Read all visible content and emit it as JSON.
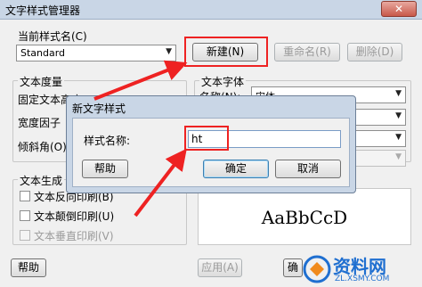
{
  "window": {
    "title": "文字样式管理器",
    "close_glyph": "✕"
  },
  "current_style": {
    "label": "当前样式名(C)",
    "value": "Standard"
  },
  "buttons": {
    "new": "新建(N)",
    "rename": "重命名(R)",
    "delete": "删除(D)",
    "help": "帮助",
    "apply": "应用(A)",
    "ok_partial": "确"
  },
  "text_measure": {
    "group_label": "文本度量",
    "fixed_height_label": "固定文本高度",
    "width_factor_label": "宽度因子",
    "oblique_label": "倾斜角(O)"
  },
  "text_font": {
    "group_label": "文本字体",
    "name_label": "名称(N):",
    "name_value": "宋体"
  },
  "text_generation": {
    "group_label": "文本生成",
    "backward": "文本反向印刷(B)",
    "upside_down": "文本颠倒印刷(U)",
    "vertical": "文本垂直印刷(V)"
  },
  "preview": {
    "text": "AaBbCcD"
  },
  "dialog": {
    "title": "新文字样式",
    "name_label": "样式名称:",
    "name_value": "ht",
    "help": "帮助",
    "ok": "确定",
    "cancel": "取消"
  },
  "watermark": {
    "brand": "资料网",
    "domain": "ZL.XSMY.COM"
  },
  "colors": {
    "annotation_red": "#ee2222",
    "watermark_blue": "#1f6fd0"
  }
}
